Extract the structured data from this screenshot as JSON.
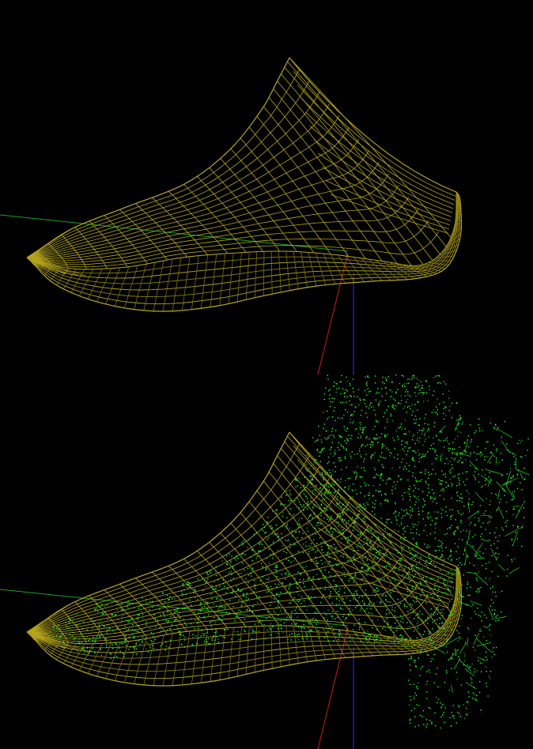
{
  "colors": {
    "background": "#000000",
    "mesh_wireframe": "#b5a51e",
    "mesh_wireframe_dark": "#8c7f14",
    "point_cloud": "#22ff22",
    "point_cloud_dark": "#10b010",
    "axis_x": "#c81e1e",
    "axis_y": "#1ea01e",
    "axis_z": "#2828d2"
  },
  "views": [
    {
      "content": [
        "shoe-last-wireframe",
        "coordinate-axes"
      ]
    },
    {
      "content": [
        "shoe-last-wireframe",
        "foot-scan-point-cloud",
        "coordinate-axes"
      ]
    }
  ]
}
